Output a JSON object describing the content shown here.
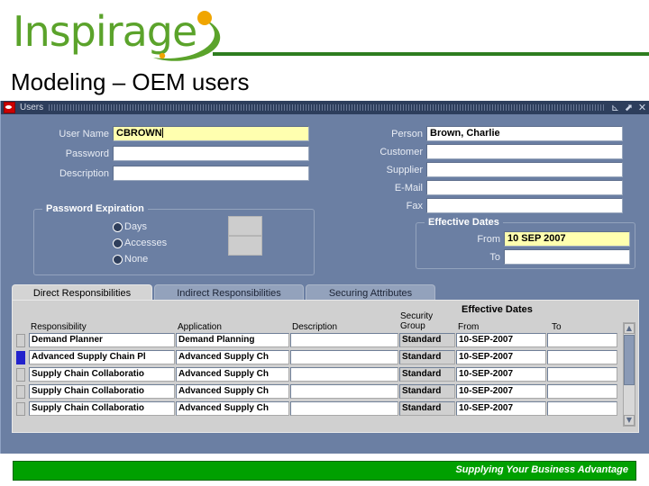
{
  "slide": {
    "logo_text": "Inspirage",
    "title": "Modeling – OEM users"
  },
  "window": {
    "title": "Users",
    "controls": {
      "minimize": "⊾",
      "maximize": "⬈",
      "close": "✕"
    }
  },
  "form": {
    "left_fields": [
      {
        "label": "User Name",
        "value": "CBROWN",
        "focused": true
      },
      {
        "label": "Password",
        "value": "",
        "focused": false
      },
      {
        "label": "Description",
        "value": "",
        "focused": false
      }
    ],
    "right_fields": [
      {
        "label": "Person",
        "value": "Brown, Charlie"
      },
      {
        "label": "Customer",
        "value": ""
      },
      {
        "label": "Supplier",
        "value": ""
      },
      {
        "label": "E-Mail",
        "value": ""
      },
      {
        "label": "Fax",
        "value": ""
      }
    ],
    "password_expiration": {
      "title": "Password Expiration",
      "options": [
        {
          "label": "Days",
          "selected": false
        },
        {
          "label": "Accesses",
          "selected": false
        },
        {
          "label": "None",
          "selected": false
        }
      ]
    },
    "effective_dates": {
      "title": "Effective Dates",
      "from_label": "From",
      "from_value": "10 SEP 2007",
      "to_label": "To",
      "to_value": ""
    }
  },
  "tabs": [
    {
      "label": "Direct Responsibilities",
      "active": true
    },
    {
      "label": "Indirect Responsibilities",
      "active": false
    },
    {
      "label": "Securing Attributes",
      "active": false
    }
  ],
  "grid": {
    "group_header": "Effective Dates",
    "columns": [
      "Responsibility",
      "Application",
      "Description",
      "Security Group",
      "From",
      "To"
    ],
    "rows": [
      {
        "responsibility": "Demand Planner",
        "application": "Demand Planning",
        "description": "",
        "security_group": "Standard",
        "from": "10-SEP-2007",
        "to": "",
        "current": false
      },
      {
        "responsibility": "Advanced Supply Chain Pl",
        "application": "Advanced Supply Ch",
        "description": "",
        "security_group": "Standard",
        "from": "10-SEP-2007",
        "to": "",
        "current": true
      },
      {
        "responsibility": "Supply Chain Collaboratio",
        "application": "Advanced Supply Ch",
        "description": "",
        "security_group": "Standard",
        "from": "10-SEP-2007",
        "to": "",
        "current": false
      },
      {
        "responsibility": "Supply Chain Collaboratio",
        "application": "Advanced Supply Ch",
        "description": "",
        "security_group": "Standard",
        "from": "10-SEP-2007",
        "to": "",
        "current": false
      },
      {
        "responsibility": "Supply Chain Collaboratio",
        "application": "Advanced Supply Ch",
        "description": "",
        "security_group": "Standard",
        "from": "10-SEP-2007",
        "to": "",
        "current": false
      }
    ]
  },
  "footer": {
    "tagline": "Supplying Your Business Advantage"
  },
  "colors": {
    "brand_green": "#5ba32b",
    "rule_green": "#2e7d1f",
    "brand_orange": "#f0a500",
    "forms_blue": "#6b7fa3",
    "titlebar": "#2d3e5c",
    "focus_yellow": "#ffffaf",
    "footer_green": "#00a000",
    "current_row": "#2222cc"
  }
}
